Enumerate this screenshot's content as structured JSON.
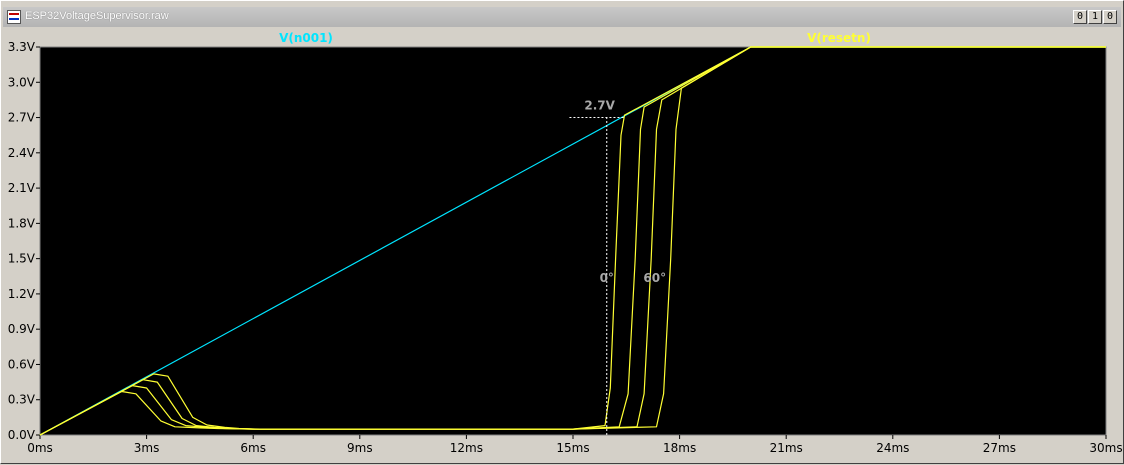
{
  "window": {
    "title": "ESP32VoltageSupervisor.raw",
    "buttons": [
      "0",
      "1",
      "0"
    ]
  },
  "colors": {
    "background": "#000000",
    "window": "#d4d0c8",
    "v_n001": "#00e5ff",
    "v_resetn": "#ffff33",
    "annotation": "#a8a8a8"
  },
  "icons": [
    "app-icon",
    "minimize-icon",
    "restore-icon",
    "close-icon"
  ],
  "chart_data": {
    "type": "line",
    "title": "",
    "xlabel": "",
    "ylabel": "",
    "xlim": [
      0,
      30
    ],
    "ylim": [
      0,
      3.3
    ],
    "xticks": [
      "0ms",
      "3ms",
      "6ms",
      "9ms",
      "12ms",
      "15ms",
      "18ms",
      "21ms",
      "24ms",
      "27ms",
      "30ms"
    ],
    "yticks": [
      "0.0V",
      "0.3V",
      "0.6V",
      "0.9V",
      "1.2V",
      "1.5V",
      "1.8V",
      "2.1V",
      "2.4V",
      "2.7V",
      "3.0V",
      "3.3V"
    ],
    "x_unit": "ms",
    "y_unit": "V",
    "grid": false,
    "legend": [
      "V(n001)",
      "V(resetn)"
    ],
    "series": [
      {
        "name": "V(n001)",
        "color": "#00e5ff",
        "x": [
          0,
          20,
          30
        ],
        "y": [
          0,
          3.3,
          3.3
        ]
      },
      {
        "name": "V(resetn)",
        "color": "#ffff33",
        "x": [
          0,
          2.3,
          2.7,
          3.4,
          3.8,
          4.5,
          5.0,
          6.0,
          9.0,
          12.0,
          15.0,
          15.9,
          16.05,
          16.2,
          16.35,
          16.45,
          20,
          30
        ],
        "y": [
          0,
          0.37,
          0.35,
          0.12,
          0.07,
          0.06,
          0.055,
          0.05,
          0.05,
          0.05,
          0.05,
          0.08,
          0.4,
          1.5,
          2.55,
          2.72,
          3.3,
          3.3
        ]
      },
      {
        "name": "V(resetn)",
        "color": "#ffff33",
        "x": [
          0,
          2.6,
          3.0,
          3.7,
          4.1,
          4.7,
          5.2,
          6.0,
          9.0,
          12.0,
          15.0,
          16.3,
          16.55,
          16.75,
          16.9,
          17.0,
          20,
          30
        ],
        "y": [
          0,
          0.42,
          0.4,
          0.13,
          0.08,
          0.065,
          0.055,
          0.05,
          0.05,
          0.05,
          0.05,
          0.07,
          0.35,
          1.5,
          2.6,
          2.79,
          3.3,
          3.3
        ]
      },
      {
        "name": "V(resetn)",
        "color": "#ffff33",
        "x": [
          0,
          2.9,
          3.3,
          4.0,
          4.4,
          4.9,
          5.4,
          6.0,
          9.0,
          12.0,
          15.0,
          16.8,
          17.0,
          17.2,
          17.35,
          17.5,
          20,
          30
        ],
        "y": [
          0,
          0.47,
          0.45,
          0.14,
          0.08,
          0.065,
          0.055,
          0.05,
          0.05,
          0.05,
          0.05,
          0.07,
          0.35,
          1.5,
          2.6,
          2.85,
          3.3,
          3.3
        ]
      },
      {
        "name": "V(resetn)",
        "color": "#ffff33",
        "x": [
          0,
          3.2,
          3.6,
          4.3,
          4.7,
          5.2,
          5.6,
          6.2,
          9.0,
          12.0,
          15.0,
          17.35,
          17.55,
          17.75,
          17.9,
          18.05,
          20,
          30
        ],
        "y": [
          0,
          0.52,
          0.5,
          0.15,
          0.085,
          0.065,
          0.055,
          0.05,
          0.05,
          0.05,
          0.05,
          0.07,
          0.35,
          1.5,
          2.6,
          2.95,
          3.3,
          3.3
        ]
      }
    ],
    "annotations": [
      {
        "text": "2.7V",
        "x": 15.75,
        "y": 2.77
      },
      {
        "text": "0°",
        "x": 15.95,
        "y": 1.3
      },
      {
        "text": "60°",
        "x": 17.3,
        "y": 1.3
      }
    ],
    "markers": [
      {
        "type": "hline",
        "y": 2.7,
        "x0": 14.9,
        "x1": 16.45
      },
      {
        "type": "vline",
        "x": 15.95,
        "y0": 0,
        "y1": 2.7
      }
    ]
  }
}
